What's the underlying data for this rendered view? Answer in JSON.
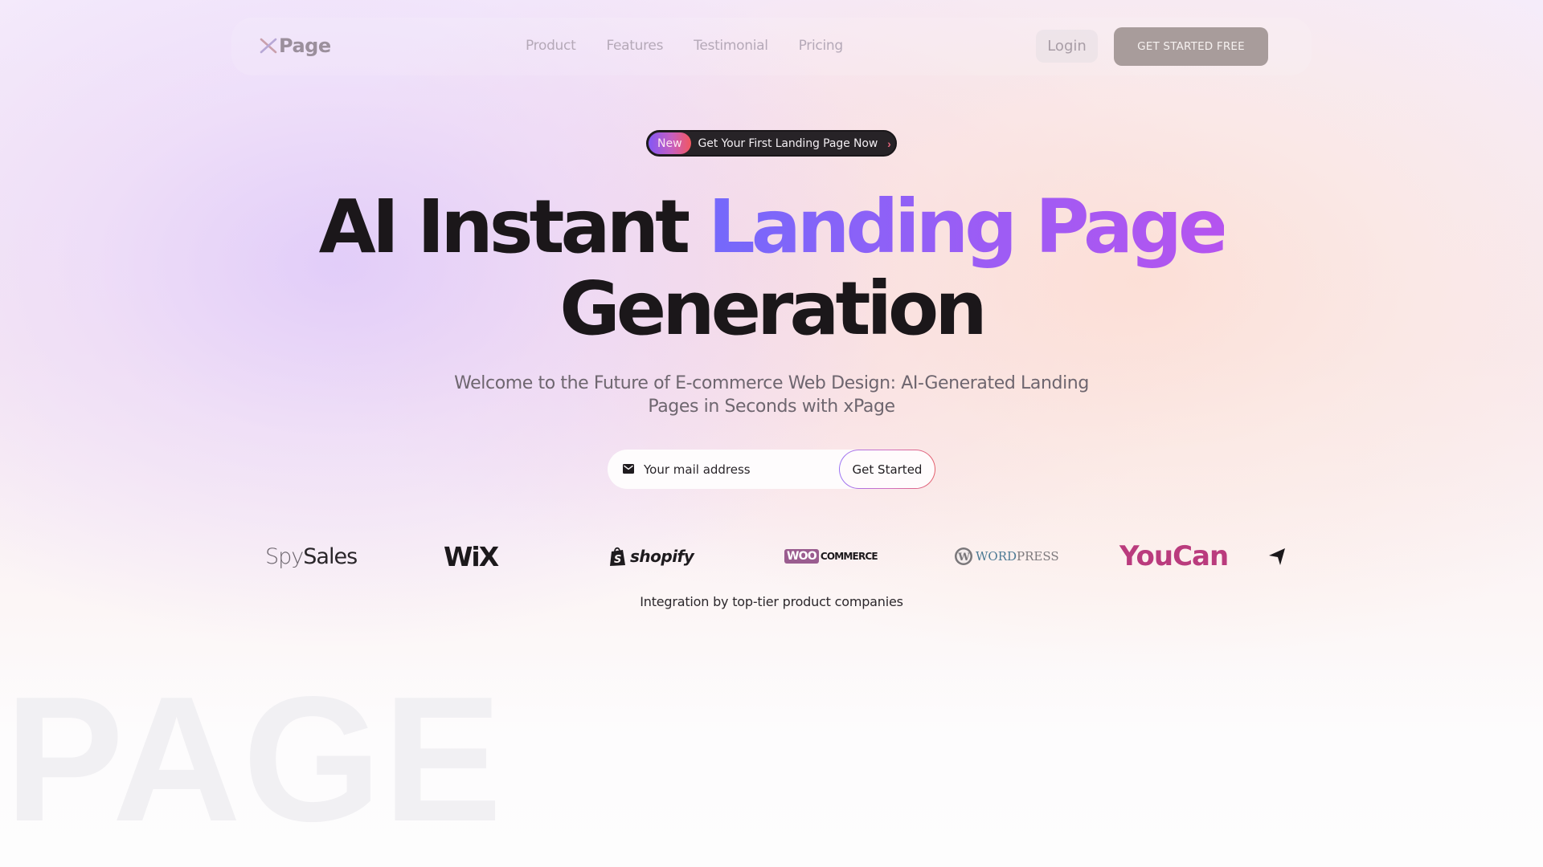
{
  "brand": {
    "name": "Page",
    "logo_mark": "X",
    "accent_gradient": [
      "#7469fb",
      "#b554ef"
    ]
  },
  "nav": {
    "links": [
      {
        "label": "Product"
      },
      {
        "label": "Features"
      },
      {
        "label": "Testimonial"
      },
      {
        "label": "Pricing"
      }
    ],
    "login_label": "Login",
    "cta_label": "GET STARTED FREE"
  },
  "announcement": {
    "badge": "New",
    "text": "Get Your First Landing Page Now",
    "chevron": "›"
  },
  "hero": {
    "headline_part1": "AI Instant ",
    "headline_highlight": "Landing Page",
    "headline_line2": "Generation",
    "subtitle": "Welcome to the Future of E-commerce Web Design: AI-Generated Landing Pages in Seconds with xPage"
  },
  "signup": {
    "email_placeholder": "Your mail address",
    "email_value": "",
    "submit_label": "Get Started",
    "icon": "mail-icon"
  },
  "integrations": {
    "logos": [
      {
        "name": "SpySales",
        "part1": "Spy",
        "part2": "Sales"
      },
      {
        "name": "Wix",
        "text": "WiX"
      },
      {
        "name": "Shopify",
        "text": "shopify"
      },
      {
        "name": "WooCommerce",
        "part1": "WOO",
        "part2": "COMMERCE"
      },
      {
        "name": "WordPress",
        "part1": "WordPress",
        "display1": "WORD",
        "display2": "PRESS"
      },
      {
        "name": "YouCan",
        "text": "YouCan"
      },
      {
        "name": "Arrow",
        "icon": "send-arrow-icon"
      }
    ],
    "caption": "Integration by top-tier product companies"
  },
  "watermark": "PAGE"
}
